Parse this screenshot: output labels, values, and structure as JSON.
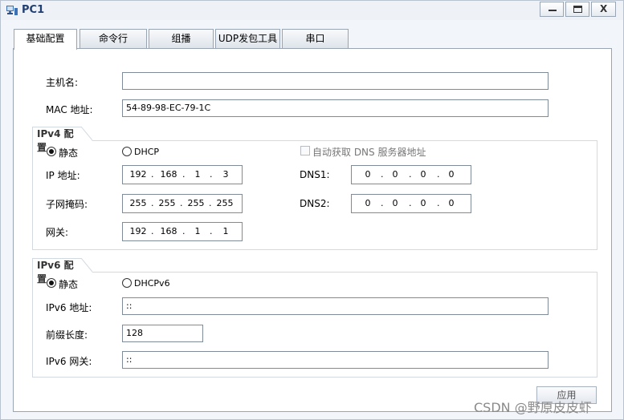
{
  "window": {
    "title": "PC1",
    "minimize": "—",
    "maximize": "☐",
    "close": "X"
  },
  "tabs": [
    "基础配置",
    "命令行",
    "组播",
    "UDP发包工具",
    "串口"
  ],
  "basic": {
    "hostname_label": "主机名:",
    "hostname_value": "",
    "mac_label": "MAC 地址:",
    "mac_value": "54-89-98-EC-79-1C"
  },
  "ipv4": {
    "section_title": "IPv4 配置",
    "static_label": "静态",
    "dhcp_label": "DHCP",
    "auto_dns_label": "自动获取 DNS 服务器地址",
    "ip_label": "IP 地址:",
    "ip": [
      "192",
      "168",
      "1",
      "3"
    ],
    "mask_label": "子网掩码:",
    "mask": [
      "255",
      "255",
      "255",
      "255"
    ],
    "gateway_label": "网关:",
    "gateway": [
      "192",
      "168",
      "1",
      "1"
    ],
    "dns1_label": "DNS1:",
    "dns1": [
      "0",
      "0",
      "0",
      "0"
    ],
    "dns2_label": "DNS2:",
    "dns2": [
      "0",
      "0",
      "0",
      "0"
    ],
    "mode": "static"
  },
  "ipv6": {
    "section_title": "IPv6 配置",
    "static_label": "静态",
    "dhcp_label": "DHCPv6",
    "addr_label": "IPv6 地址:",
    "addr_value": "::",
    "prefix_label": "前缀长度:",
    "prefix_value": "128",
    "gateway_label": "IPv6 网关:",
    "gateway_value": "::",
    "mode": "static"
  },
  "apply_label": "应用",
  "watermark": "CSDN @野原皮皮虾"
}
